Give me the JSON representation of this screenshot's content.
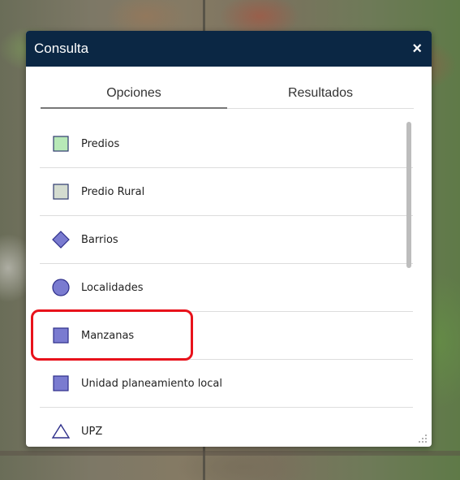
{
  "panel": {
    "title": "Consulta",
    "close_glyph": "×"
  },
  "tabs": [
    {
      "label": "Opciones",
      "active": true
    },
    {
      "label": "Resultados",
      "active": false
    }
  ],
  "layers": [
    {
      "label": "Predios",
      "icon": "square-icon",
      "fill": "#b7e8b7",
      "stroke": "#2e3a6e"
    },
    {
      "label": "Predio Rural",
      "icon": "square-icon",
      "fill": "#d4dcd0",
      "stroke": "#2e3a6e"
    },
    {
      "label": "Barrios",
      "icon": "diamond-icon",
      "fill": "#7a7bd0",
      "stroke": "#2e2f8a"
    },
    {
      "label": "Localidades",
      "icon": "circle-icon",
      "fill": "#7a7bd0",
      "stroke": "#2e2f8a"
    },
    {
      "label": "Manzanas",
      "icon": "square-icon",
      "fill": "#7a7bd0",
      "stroke": "#2e2f8a"
    },
    {
      "label": "Unidad planeamiento local",
      "icon": "square-icon",
      "fill": "#7a7bd0",
      "stroke": "#2e2f8a"
    },
    {
      "label": "UPZ",
      "icon": "triangle-icon",
      "fill": "#ffffff",
      "stroke": "#2e2f8a"
    }
  ],
  "colors": {
    "header_bg": "#0b2744",
    "highlight": "#e8121b"
  }
}
